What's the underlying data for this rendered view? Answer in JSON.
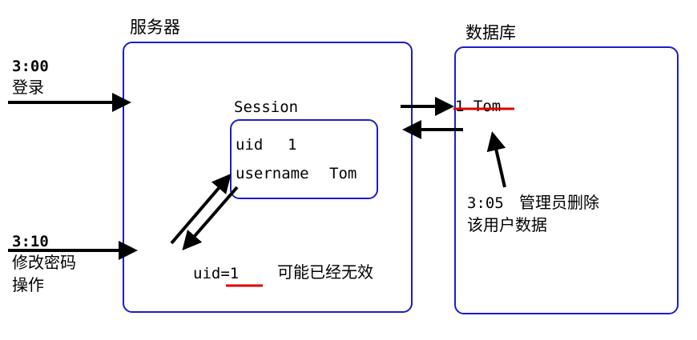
{
  "server": {
    "title": "服务器",
    "session": {
      "title": "Session",
      "uid_label": "uid",
      "uid_value": "1",
      "username_label": "username",
      "username_value": "Tom"
    },
    "note_value": "uid=1",
    "note_text": "可能已经无效"
  },
  "database": {
    "title": "数据库",
    "record": "1 Tom",
    "admin_time": "3:05",
    "admin_action": "管理员删除",
    "admin_action_line2": "该用户数据"
  },
  "events": {
    "login_time": "3:00",
    "login_action": "登录",
    "change_time": "3:10",
    "change_action_line1": "修改密码",
    "change_action_line2": "操作"
  },
  "colors": {
    "box_border": "#1c1ccc",
    "strike": "#dd0000",
    "arrow": "#000000"
  }
}
